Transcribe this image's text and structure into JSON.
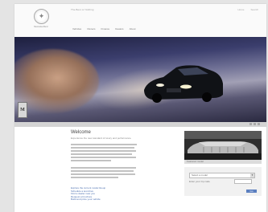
{
  "header": {
    "logo_glyph": "✦",
    "brand": "Mercedes-Benz",
    "tagline": "The Best or Nothing",
    "utility_links": [
      "Home",
      "Search"
    ],
    "nav": [
      "Vehicles",
      "Owners",
      "Finance",
      "Dealers",
      "About"
    ]
  },
  "hero": {
    "badge": "M"
  },
  "main": {
    "headline": "Welcome",
    "subline": "Experience the new standard of luxury and performance.",
    "links": [
      "Explore the current model lineup",
      "Schedule a test drive",
      "Find a dealer near you",
      "Request a brochure",
      "Build and price your vehicle"
    ]
  },
  "side": {
    "caption": "Featured model",
    "select_value": "Select a model",
    "select_arrow": "▼",
    "label": "Enter your zip code",
    "go": "Go"
  }
}
